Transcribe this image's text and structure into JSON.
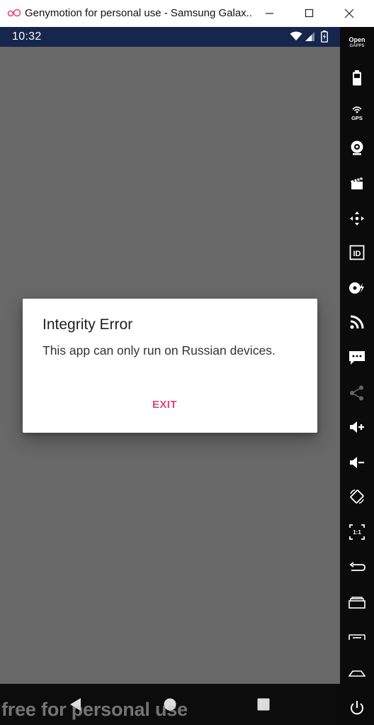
{
  "window": {
    "title": "Genymotion for personal use - Samsung Galax..."
  },
  "statusbar": {
    "time": "10:32"
  },
  "dialog": {
    "title": "Integrity Error",
    "message": "This app can only run on Russian devices.",
    "exit_label": "EXIT",
    "accent": "#e0457b"
  },
  "watermark": "free for personal use",
  "toolbar": {
    "open_gapps_top": "Open",
    "open_gapps_bottom": "GAPPS",
    "gps_label": "GPS",
    "id_label": "ID",
    "pixel_label": "1:1"
  },
  "colors": {
    "screen_bg": "#686868",
    "statusbar_bg": "#17264c",
    "toolbar_bg": "#0b0b0b"
  }
}
